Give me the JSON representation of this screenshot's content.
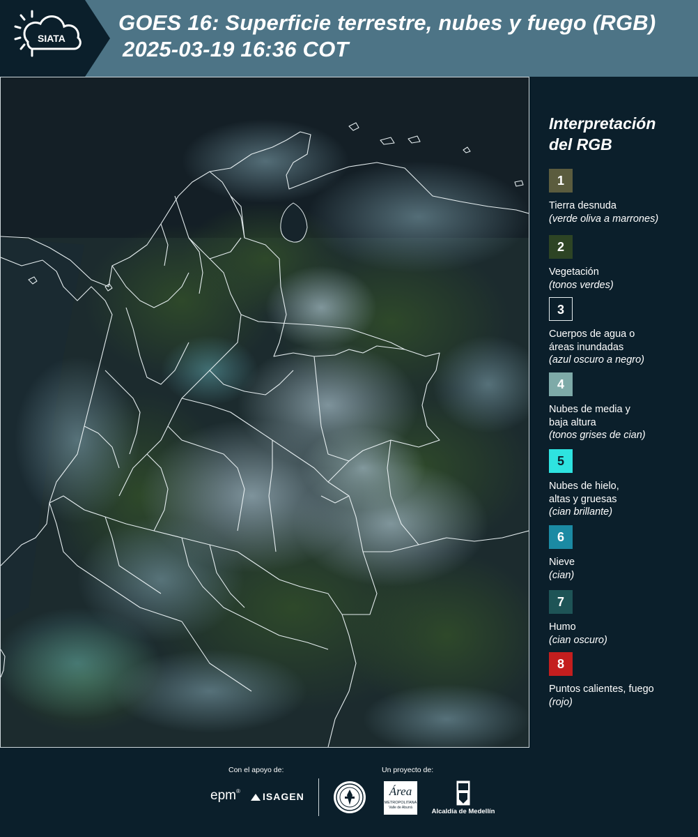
{
  "header": {
    "logo_text": "SIATA",
    "title_line1": "GOES 16: Superficie terrestre, nubes y fuego (RGB)",
    "title_line2": "2025-03-19 16:36 COT"
  },
  "legend": {
    "title_line1": "Interpretación",
    "title_line2": "del RGB",
    "items": [
      {
        "number": "1",
        "color": "#5b5c3e",
        "lines": [
          "Tierra desnuda"
        ],
        "note": "(verde oliva a marrones)"
      },
      {
        "number": "2",
        "color": "#2d4424",
        "lines": [
          "Vegetación"
        ],
        "note": "(tonos verdes)"
      },
      {
        "number": "3",
        "color": "#0b1f2b",
        "lines": [
          "Cuerpos de agua o",
          "áreas inundadas"
        ],
        "note": "(azul oscuro a negro)"
      },
      {
        "number": "4",
        "color": "#7eaaa8",
        "lines": [
          "Nubes de media y",
          "baja altura"
        ],
        "note": "(tonos grises de cian)"
      },
      {
        "number": "5",
        "color": "#2ee3e0",
        "lines": [
          "Nubes de hielo,",
          "altas y gruesas"
        ],
        "note": "(cian brillante)"
      },
      {
        "number": "6",
        "color": "#1b8aa3",
        "lines": [
          "Nieve"
        ],
        "note": "(cian)"
      },
      {
        "number": "7",
        "color": "#1e5456",
        "lines": [
          "Humo"
        ],
        "note": "(cian oscuro)"
      },
      {
        "number": "8",
        "color": "#c41e1e",
        "lines": [
          "Puntos calientes, fuego"
        ],
        "note": "(rojo)"
      }
    ]
  },
  "footer": {
    "support_label": "Con el apoyo de:",
    "project_label": "Un proyecto de:",
    "epm_text": "epm",
    "isagen_text": "ISAGEN",
    "area_text": "Área",
    "area_sub": "METROPOLITANA",
    "area_sub2": "Valle de Aburrá",
    "alcaldia_text": "Alcaldía de Medellín"
  }
}
